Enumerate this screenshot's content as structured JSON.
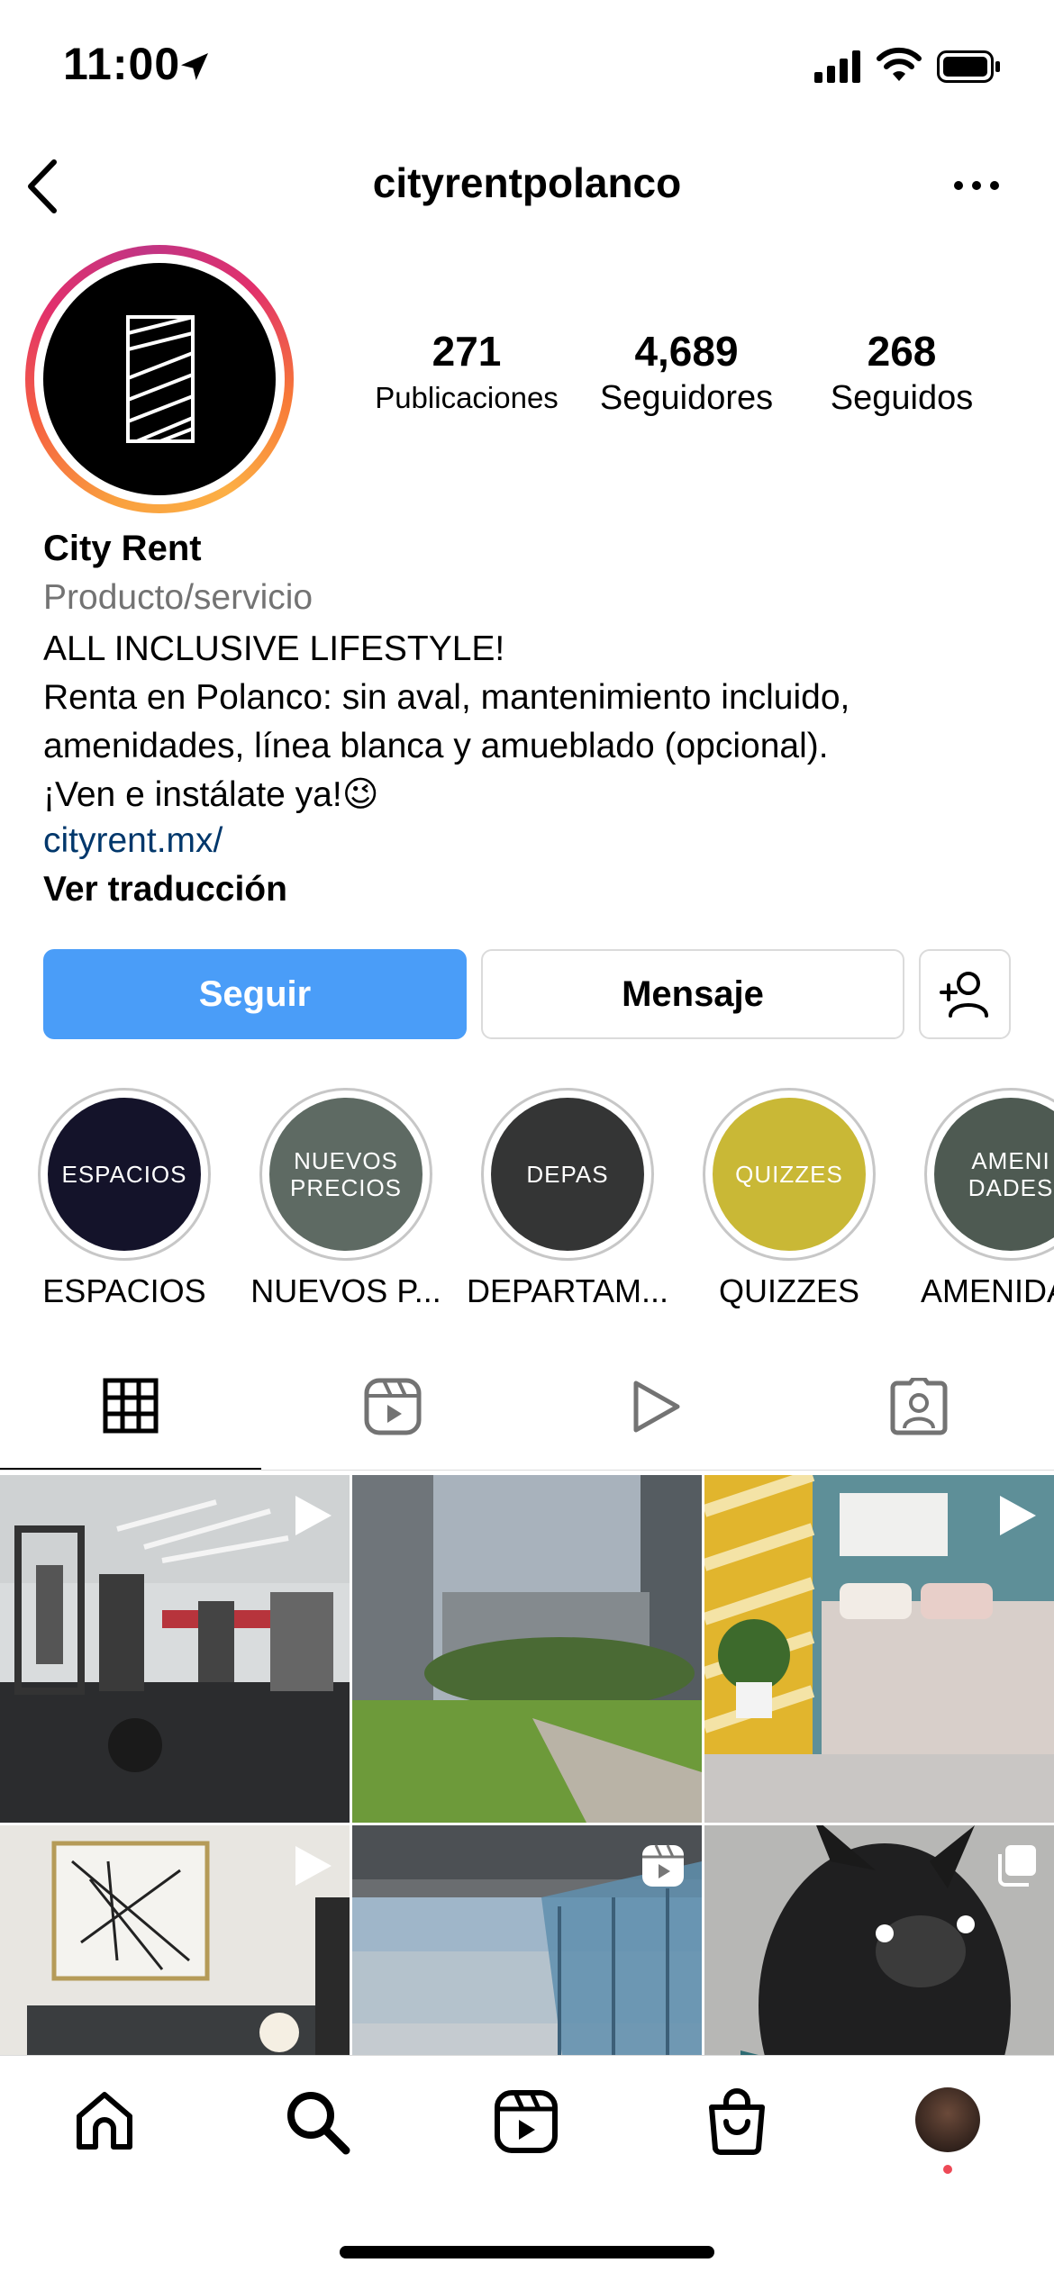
{
  "status_bar": {
    "time": "11:00"
  },
  "header": {
    "username": "cityrentpolanco"
  },
  "stats": [
    {
      "value": "271",
      "label": "Publicaciones"
    },
    {
      "value": "4,689",
      "label": "Seguidores"
    },
    {
      "value": "268",
      "label": "Seguidos"
    }
  ],
  "bio": {
    "name": "City Rent",
    "category": "Producto/servicio",
    "lines": [
      "ALL INCLUSIVE LIFESTYLE!",
      "Renta en Polanco: sin aval, mantenimiento incluido,",
      "amenidades, línea blanca y amueblado (opcional).",
      "¡Ven e instálate ya!😉"
    ],
    "link": "cityrent.mx/",
    "see_translation": "Ver traducción"
  },
  "actions": {
    "follow": "Seguir",
    "message": "Mensaje"
  },
  "highlights": [
    {
      "cover_text": "ESPACIOS",
      "label": "ESPACIOS",
      "color": "#14132a"
    },
    {
      "cover_text": "NUEVOS PRECIOS",
      "label": "NUEVOS P...",
      "color": "#5e6a63"
    },
    {
      "cover_text": "DEPAS",
      "label": "DEPARTAM...",
      "color": "#343535"
    },
    {
      "cover_text": "QUIZZES",
      "label": "QUIZZES",
      "color": "#c9b836"
    },
    {
      "cover_text": "AMENI DADES",
      "label": "AMENIDA",
      "color": "#4e5a52"
    }
  ],
  "tabs": [
    "grid-tab",
    "reels-tab",
    "videos-tab",
    "tagged-tab"
  ],
  "grid": [
    {
      "kind": "video",
      "scene": "gym"
    },
    {
      "kind": "photo",
      "scene": "garden"
    },
    {
      "kind": "video",
      "scene": "bedroom"
    },
    {
      "kind": "video",
      "scene": "bedroom-art"
    },
    {
      "kind": "reel",
      "scene": "balcony"
    },
    {
      "kind": "carousel",
      "scene": "dog"
    }
  ],
  "bottom_nav": [
    "home-icon",
    "search-icon",
    "reels-icon",
    "shop-icon",
    "profile-avatar"
  ]
}
